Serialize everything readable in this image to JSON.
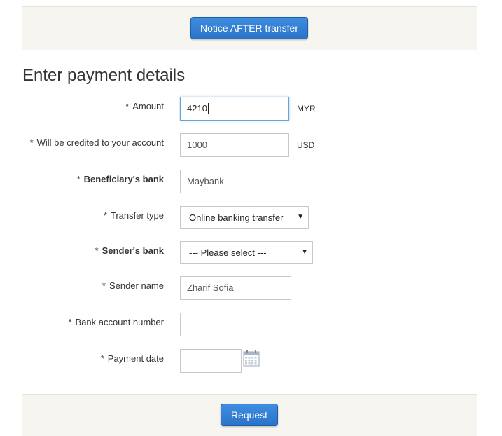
{
  "top_bar": {
    "notice_button_label": "Notice AFTER transfer",
    "accent_color": "#2a74c8"
  },
  "form": {
    "title": "Enter payment details",
    "required_marker": "*",
    "amount": {
      "label": "Amount",
      "value": "4210",
      "unit": "MYR"
    },
    "credited": {
      "label": "Will be credited to your account",
      "value": "1000",
      "unit": "USD"
    },
    "beneficiary_bank": {
      "label": "Beneficiary's bank",
      "value": "Maybank"
    },
    "transfer_type": {
      "label": "Transfer type",
      "selected": "Online banking transfer"
    },
    "sender_bank": {
      "label": "Sender's bank",
      "selected": "--- Please select ---"
    },
    "sender_name": {
      "label": "Sender name",
      "value": "Zharif Sofia"
    },
    "bank_account_number": {
      "label": "Bank account number",
      "value": ""
    },
    "payment_date": {
      "label": "Payment date",
      "value": "",
      "icon": "calendar-icon"
    }
  },
  "footer": {
    "request_button_label": "Request"
  },
  "icons": {
    "dropdown": "chevron-down-icon",
    "calendar": "calendar-icon"
  }
}
